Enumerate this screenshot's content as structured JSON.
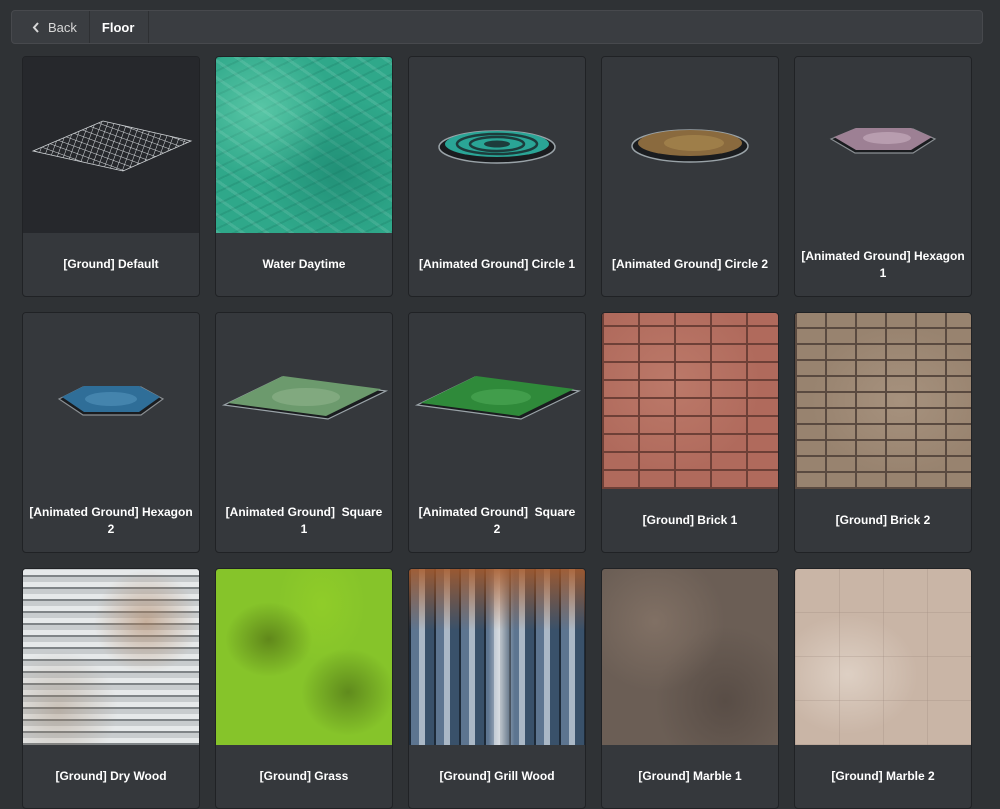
{
  "header": {
    "back_label": "Back",
    "breadcrumb": "Floor"
  },
  "items": [
    {
      "label": "[Ground] Default",
      "thumbnail": "wireframe-grid-tile"
    },
    {
      "label": "Water Daytime",
      "thumbnail": "water-texture"
    },
    {
      "label": "[Animated Ground] Circle 1",
      "thumbnail": "teal-circle-platform"
    },
    {
      "label": "[Animated Ground] Circle 2",
      "thumbnail": "brown-circle-platform"
    },
    {
      "label": "[Animated Ground] Hexagon 1",
      "thumbnail": "pink-hexagon-platform"
    },
    {
      "label": "[Animated Ground] Hexagon 2",
      "thumbnail": "blue-hexagon-platform"
    },
    {
      "label": "[Animated Ground]  Square 1",
      "thumbnail": "light-green-square-platform"
    },
    {
      "label": "[Animated Ground]  Square 2",
      "thumbnail": "green-square-platform"
    },
    {
      "label": "[Ground] Brick 1",
      "thumbnail": "red-brick-texture"
    },
    {
      "label": "[Ground] Brick 2",
      "thumbnail": "tan-brick-texture"
    },
    {
      "label": "[Ground] Dry Wood",
      "thumbnail": "dry-wood-texture"
    },
    {
      "label": "[Ground] Grass",
      "thumbnail": "grass-texture"
    },
    {
      "label": "[Ground] Grill Wood",
      "thumbnail": "grill-wood-texture"
    },
    {
      "label": "[Ground] Marble 1",
      "thumbnail": "dark-marble-texture"
    },
    {
      "label": "[Ground] Marble 2",
      "thumbnail": "light-marble-texture"
    }
  ],
  "colors": {
    "background": "#2f3235",
    "card": "#35383c",
    "topbar": "#3a3d41",
    "text": "#ffffff"
  }
}
